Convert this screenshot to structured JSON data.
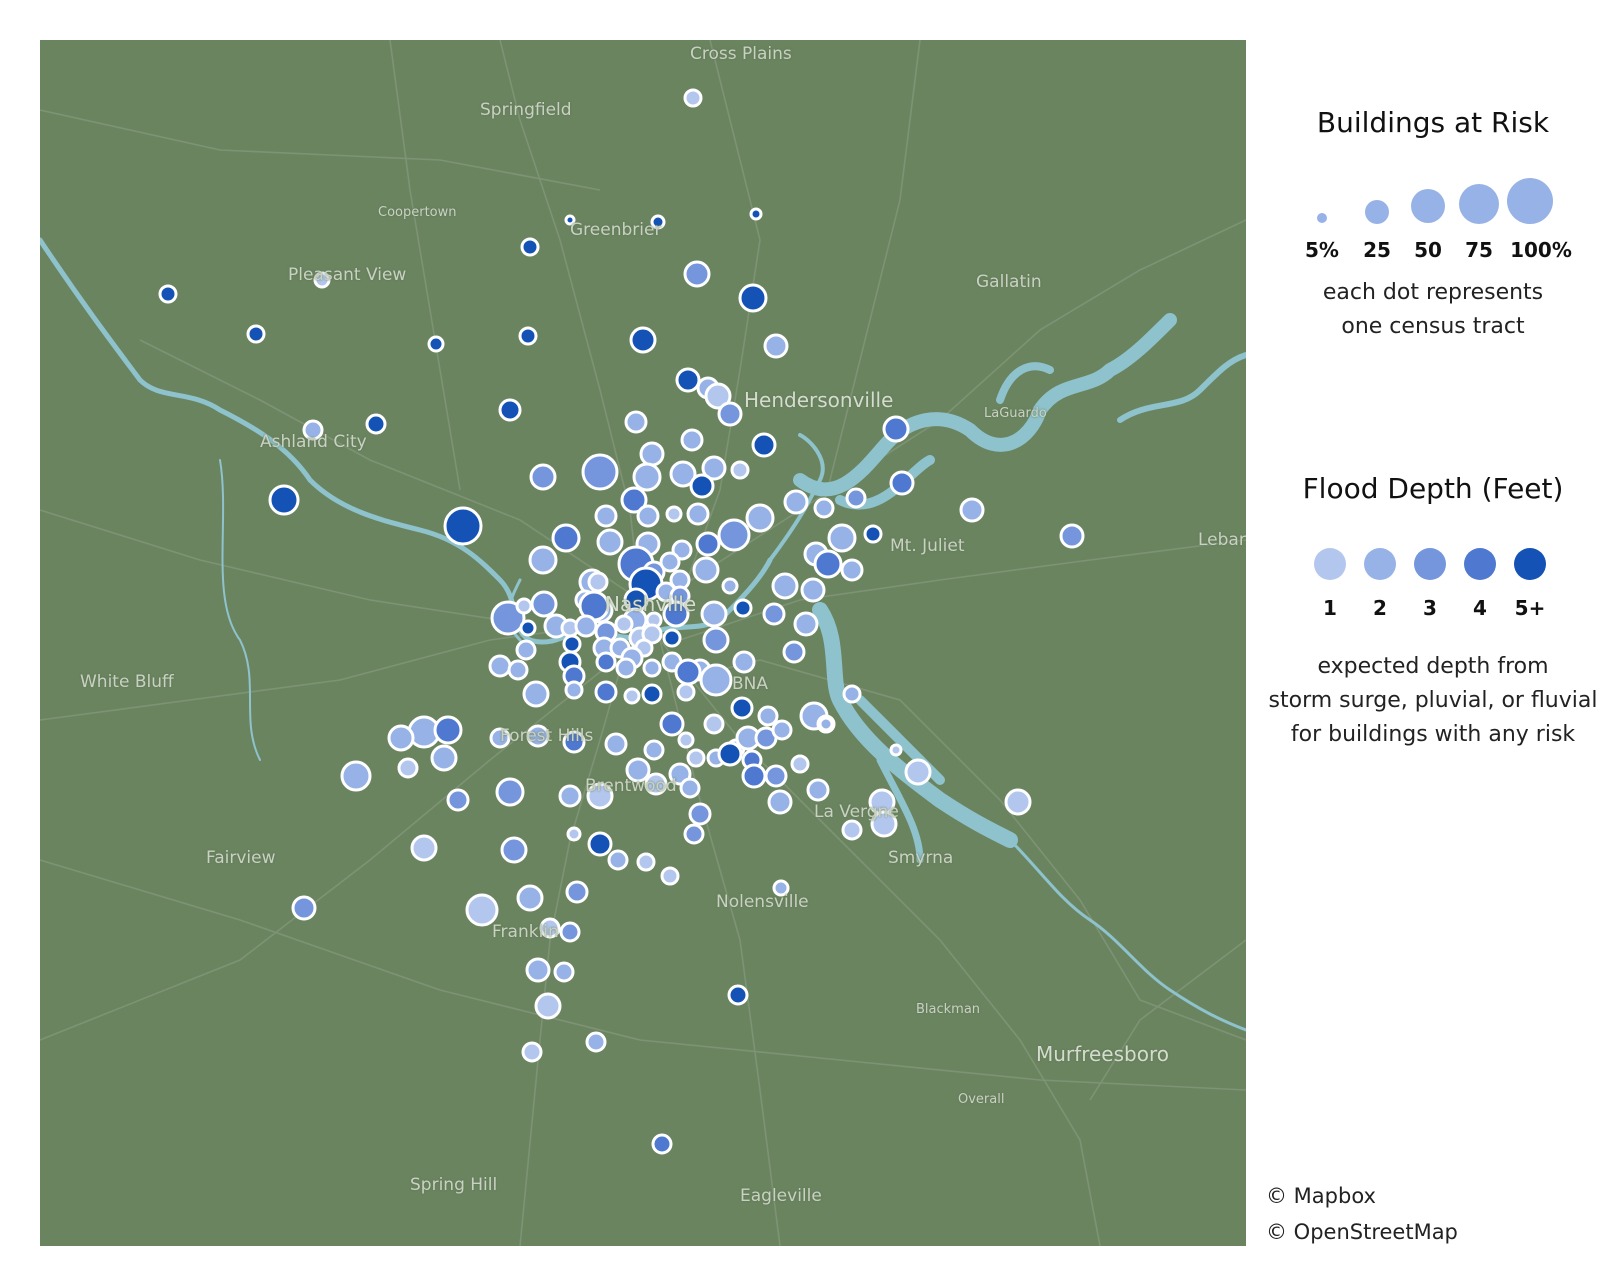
{
  "legend": {
    "size_title": "Buildings at Risk",
    "size_labels": [
      "5%",
      "25",
      "50",
      "75",
      "100%"
    ],
    "size_note_1": "each dot represents",
    "size_note_2": "one census tract",
    "depth_title": "Flood Depth (Feet)",
    "depth_labels": [
      "1",
      "2",
      "3",
      "4",
      "5+"
    ],
    "depth_note_1": "expected depth from",
    "depth_note_2": "storm surge, pluvial, or fluvial",
    "depth_note_3": "for buildings with any risk",
    "depth_colors": [
      "#b3c7ee",
      "#97b2e6",
      "#7596dd",
      "#4f78d0",
      "#1452b5"
    ]
  },
  "attribution": [
    "© Mapbox",
    "© OpenStreetMap"
  ],
  "places": [
    "Cross Plains",
    "Springfield",
    "Coopertown",
    "Greenbrier",
    "Pleasant View",
    "Gallatin",
    "Hendersonville",
    "LaGuardo",
    "Ashland City",
    "Mt. Juliet",
    "Lebar",
    "Nashville",
    "White Bluff",
    "BNA",
    "Forest Hills",
    "Brentwood",
    "La Vergne",
    "Fairview",
    "Smyrna",
    "Nolensville",
    "Franklin",
    "Blackman",
    "Murfreesboro",
    "Overall",
    "Spring Hill",
    "Eagleville"
  ],
  "colors": {
    "land": "#6b8460",
    "water": "#8ec2cc",
    "road": "#869a7e"
  }
}
